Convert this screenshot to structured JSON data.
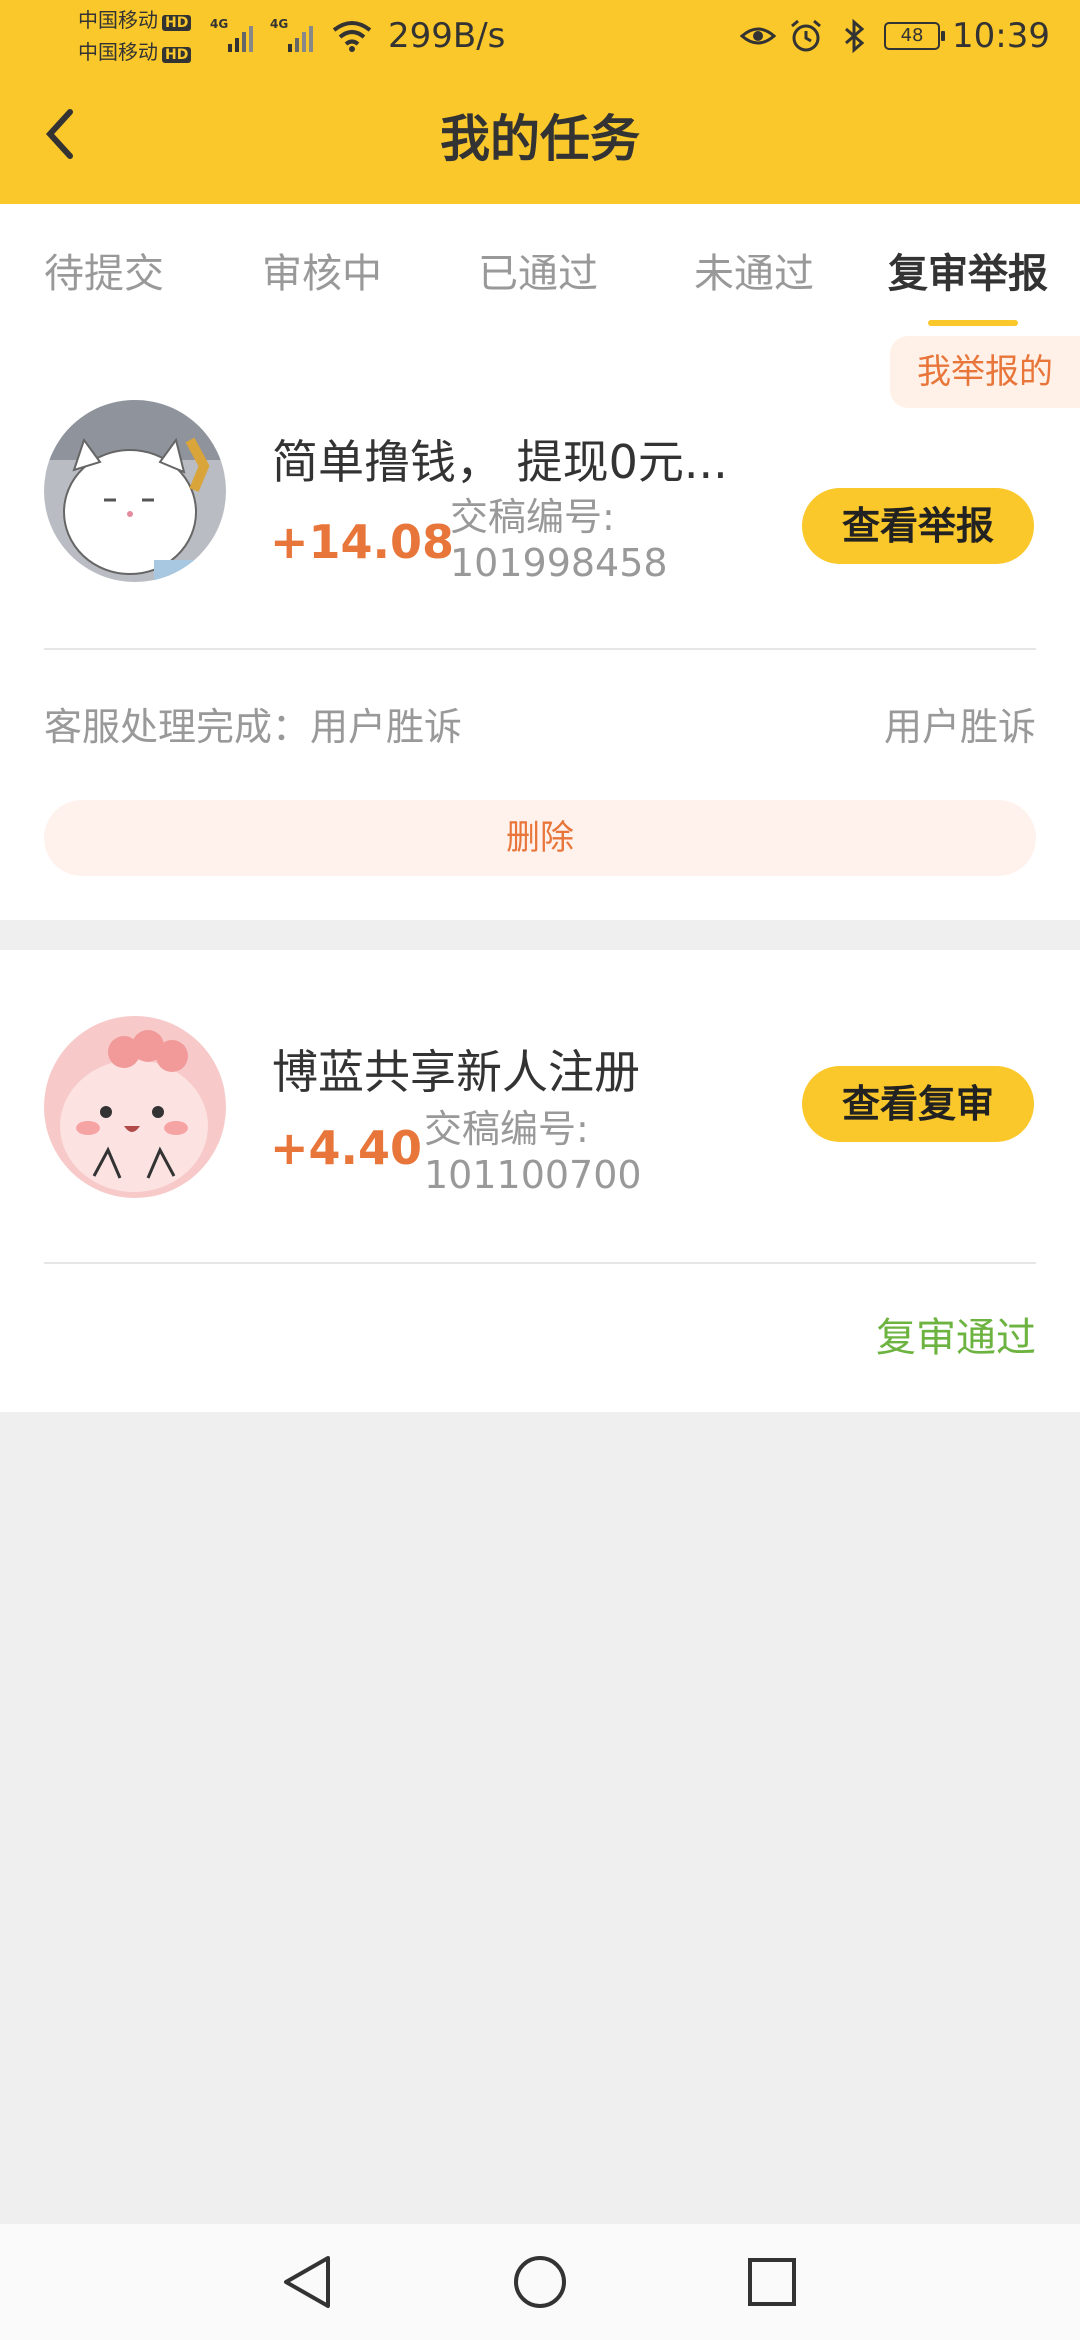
{
  "status_bar": {
    "carrier_1": "中国移动",
    "carrier_2": "中国移动",
    "hd": "HD",
    "network": "4G",
    "speed": "299B/s",
    "battery": "48",
    "time": "10:39",
    "icons": [
      "signal-icon",
      "wifi-icon",
      "eye-icon",
      "alarm-icon",
      "bluetooth-icon",
      "battery-icon"
    ]
  },
  "header": {
    "title": "我的任务",
    "back_icon": "chevron-left-icon"
  },
  "tabs": [
    {
      "label": "待提交",
      "active": false
    },
    {
      "label": "审核中",
      "active": false
    },
    {
      "label": "已通过",
      "active": false
    },
    {
      "label": "未通过",
      "active": false
    },
    {
      "label": "复审举报",
      "active": true
    }
  ],
  "filter_tag": "我举报的",
  "tasks": [
    {
      "title": "简单撸钱， 提现0元...",
      "amount": "+14.08",
      "code_label": "交稿编号:",
      "code": "101998458",
      "action": "查看举报",
      "result_left": "客服处理完成：用户胜诉",
      "result_right": "用户胜诉",
      "delete": "删除"
    },
    {
      "title": "博蓝共享新人注册",
      "amount": "+4.40",
      "code_label": "交稿编号:",
      "code": "101100700",
      "action": "查看复审",
      "result_right": "复审通过"
    }
  ],
  "colors": {
    "brand": "#FAC82A",
    "amount": "#E8763A",
    "pass": "#6DB33F",
    "background": "#EFEFEF"
  },
  "nav": [
    "back-triangle-icon",
    "home-circle-icon",
    "recents-square-icon"
  ]
}
